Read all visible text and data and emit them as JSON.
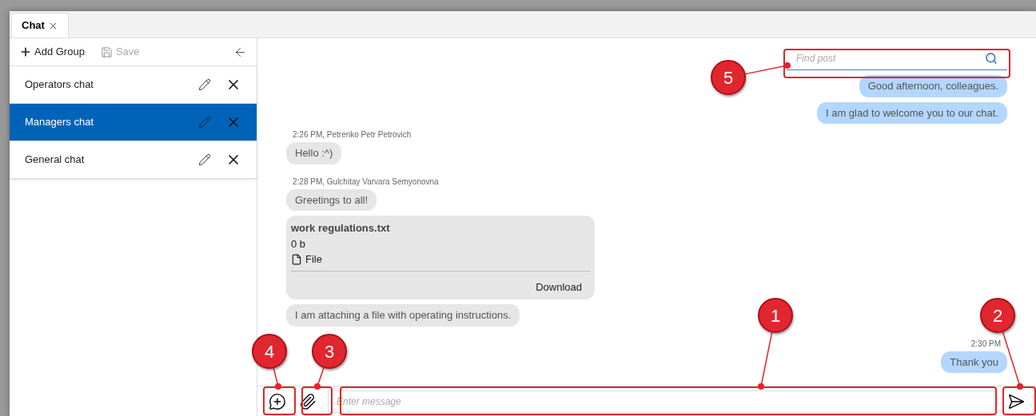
{
  "tabs": [
    {
      "label": "Chat",
      "selected": true
    }
  ],
  "toolbar": {
    "add_group": "Add Group",
    "save": "Save",
    "save_disabled": true
  },
  "groups": [
    {
      "name": "Operators chat",
      "selected": false
    },
    {
      "name": "Managers chat",
      "selected": true
    },
    {
      "name": "General chat",
      "selected": false
    }
  ],
  "search": {
    "placeholder": "Find post"
  },
  "messages": [
    {
      "kind": "outgoing",
      "text": "Good afternoon, colleagues."
    },
    {
      "kind": "outgoing",
      "text": "I am glad to welcome you to our chat."
    },
    {
      "kind": "incoming",
      "meta": "2:26 PM, Petrenko Petr Petrovich",
      "text": "Hello :^)"
    },
    {
      "kind": "incoming",
      "meta": "2:28 PM, Gulchitay Varvara Semyonovna",
      "text": "Greetings to all!"
    },
    {
      "kind": "file",
      "name": "work regulations.txt",
      "size": "0 b",
      "type": "File",
      "action": "Download"
    },
    {
      "kind": "incoming",
      "text": "I am attaching a file with operating instructions."
    },
    {
      "kind": "outgoing",
      "meta": "2:30 PM",
      "text": "Thank you"
    }
  ],
  "composer": {
    "placeholder": "Enter message"
  },
  "callouts": [
    {
      "number": "1",
      "kind": "message"
    },
    {
      "number": "2",
      "kind": "send"
    },
    {
      "number": "3",
      "kind": "attach"
    },
    {
      "number": "4",
      "kind": "new"
    },
    {
      "number": "5",
      "kind": "search"
    }
  ]
}
